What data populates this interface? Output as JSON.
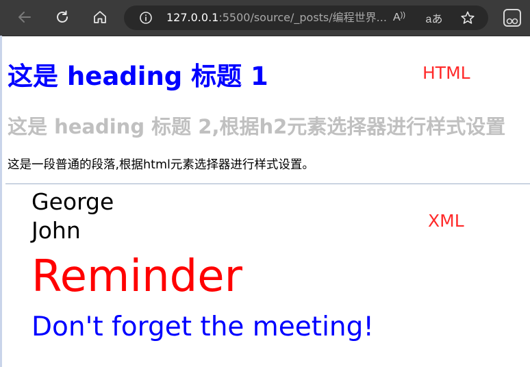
{
  "browser": {
    "url_host": "127.0.0.1",
    "url_rest": ":5500/source/_posts/编程世界...",
    "icons": [
      "back-arrow-icon",
      "reload-icon",
      "home-icon",
      "info-icon",
      "read-aloud-icon",
      "translate-icon",
      "favorite-star-icon",
      "profile-icon"
    ],
    "read_aloud_glyph": "A",
    "translate_glyph": "aあ"
  },
  "page": {
    "h1": "这是 heading 标题 1",
    "html_label": "HTML",
    "h2": "这是 heading 标题 2,根据h2元素选择器进行样式设置",
    "paragraph": "这是一段普通的段落,根据html元素选择器进行样式设置。"
  },
  "xml": {
    "to": "George",
    "from": "John",
    "heading": "Reminder",
    "body": "Don't forget the meeting!",
    "label": "XML"
  },
  "colors": {
    "h1": "#0000ff",
    "h2": "#c0c0c0",
    "label": "#ff2a2a",
    "xml_heading": "#ff0000",
    "xml_body": "#0000ff",
    "toolbar": "#3b3b3b"
  }
}
